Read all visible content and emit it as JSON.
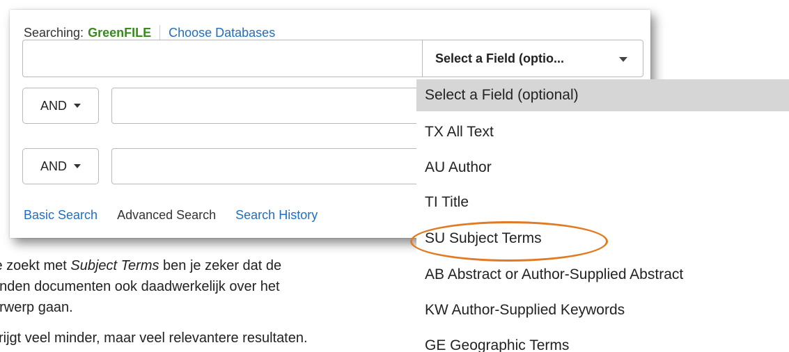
{
  "search": {
    "searching_label": "Searching:",
    "database": "GreenFILE",
    "choose_databases": "Choose Databases",
    "main_query_value": "",
    "field_select_value": "Select a Field (optio...",
    "rows": [
      {
        "operator": "AND",
        "value": ""
      },
      {
        "operator": "AND",
        "value": ""
      }
    ]
  },
  "links": {
    "basic": "Basic Search",
    "advanced": "Advanced Search",
    "history": "Search History"
  },
  "dropdown": {
    "items": [
      {
        "label": "Select a Field (optional)",
        "selected": true
      },
      {
        "label": "TX All Text",
        "selected": false
      },
      {
        "label": "AU Author",
        "selected": false
      },
      {
        "label": "TI Title",
        "selected": false
      },
      {
        "label": "SU Subject Terms",
        "selected": false,
        "highlighted": true
      },
      {
        "label": "AB Abstract or Author-Supplied Abstract",
        "selected": false
      },
      {
        "label": "KW Author-Supplied Keywords",
        "selected": false
      },
      {
        "label": "GE Geographic Terms",
        "selected": false
      }
    ]
  },
  "explanation": {
    "line1_a": "je zoekt met ",
    "line1_em": "Subject Terms",
    "line1_b": " ben je zeker dat de",
    "line2": "onden documenten ook daadwerkelijk over het",
    "line3": "erwerp gaan.",
    "line4": "krijgt veel minder, maar veel relevantere resultaten."
  },
  "colors": {
    "link": "#1f6ec2",
    "database": "#3a8a1f",
    "highlight_ring": "#e07b23",
    "selected_item_bg": "#d6d6d6"
  }
}
